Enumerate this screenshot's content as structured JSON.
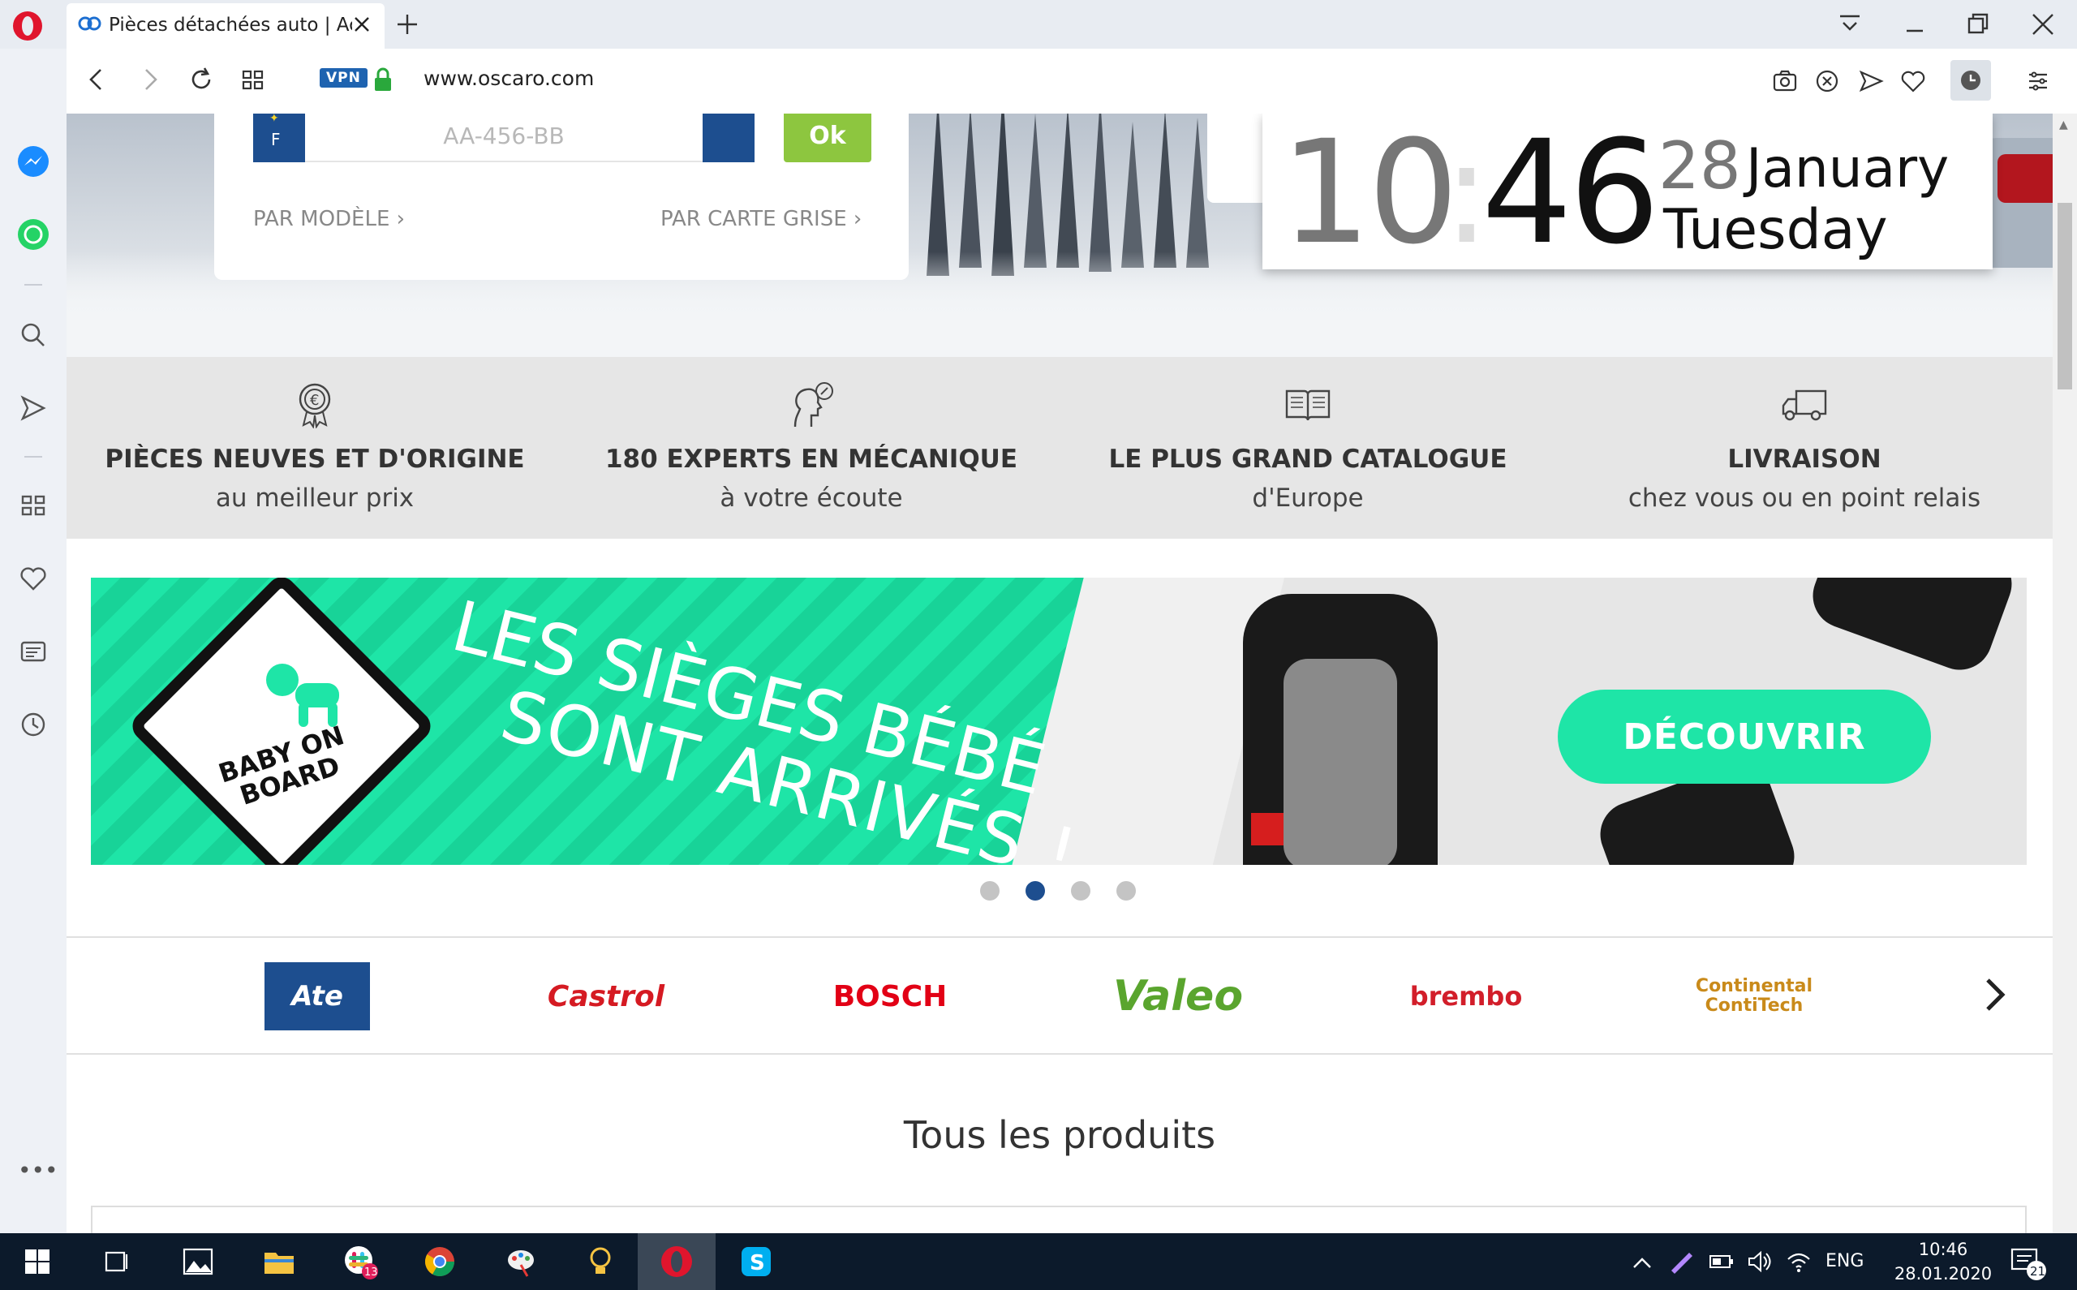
{
  "browser": {
    "tab_title": "Pièces détachées auto | Achat",
    "url": "www.oscaro.com",
    "vpn_label": "VPN"
  },
  "search": {
    "country_code": "F",
    "plate_placeholder": "AA-456-BB",
    "ok_label": "Ok",
    "link_model": "PAR MODÈLE ›",
    "link_registration": "PAR CARTE GRISE ›"
  },
  "clock_widget": {
    "hour": "10",
    "colon": ":",
    "minute": "46",
    "day": "28",
    "month": "January",
    "weekday": "Tuesday"
  },
  "features": [
    {
      "title": "PIÈCES NEUVES ET D'ORIGINE",
      "subtitle": "au meilleur prix",
      "icon": "badge-euro-icon"
    },
    {
      "title": "180 EXPERTS EN MÉCANIQUE",
      "subtitle": "à votre écoute",
      "icon": "expert-head-icon"
    },
    {
      "title": "LE PLUS GRAND CATALOGUE",
      "subtitle": "d'Europe",
      "icon": "book-icon"
    },
    {
      "title": "LIVRAISON",
      "subtitle": "chez vous ou en point relais",
      "icon": "truck-icon"
    }
  ],
  "banner": {
    "sign_text": "BABY ON BOARD",
    "headline_1": "LES SIÈGES BÉBÉ",
    "headline_2": "SONT ARRIVÉS !",
    "cta": "DÉCOUVRIR",
    "active_slide": 2,
    "slide_count": 4
  },
  "brands": [
    "Ate",
    "Castrol",
    "BOSCH",
    "Valeo",
    "brembo",
    "Continental ContiTech"
  ],
  "products_title": "Tous les produits",
  "taskbar": {
    "lang": "ENG",
    "time": "10:46",
    "date": "28.01.2020",
    "slack_badge": "13",
    "notifications_badge": "21"
  },
  "colors": {
    "brand_blue": "#1d4e8f",
    "ok_green": "#8dc63f",
    "banner_green": "#1ee5a7"
  }
}
